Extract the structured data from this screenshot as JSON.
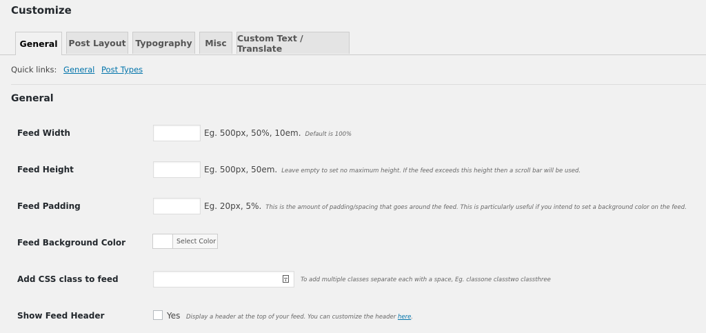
{
  "header": {
    "title": "Customize"
  },
  "tabs": [
    {
      "label": "General",
      "active": true
    },
    {
      "label": "Post Layout"
    },
    {
      "label": "Typography"
    },
    {
      "label": "Misc"
    },
    {
      "label": "Custom Text / Translate"
    }
  ],
  "quick_links": {
    "label": "Quick links:",
    "links": [
      "General",
      "Post Types"
    ]
  },
  "section": {
    "title": "General"
  },
  "settings": {
    "feed_width": {
      "label": "Feed Width",
      "value": "",
      "hint": "Eg. 500px, 50%, 10em.",
      "note": "Default is 100%"
    },
    "feed_height": {
      "label": "Feed Height",
      "value": "",
      "hint": "Eg. 500px, 50em.",
      "note": "Leave empty to set no maximum height. If the feed exceeds this height then a scroll bar will be used."
    },
    "feed_padding": {
      "label": "Feed Padding",
      "value": "",
      "hint": "Eg. 20px, 5%.",
      "note": "This is the amount of padding/spacing that goes around the feed. This is particularly useful if you intend to set a background color on the feed."
    },
    "feed_bg_color": {
      "label": "Feed Background Color",
      "button_label": "Select Color",
      "swatch": "#ffffff"
    },
    "css_class": {
      "label": "Add CSS class to feed",
      "value": "",
      "icon": "calendar-icon",
      "note": "To add multiple classes separate each with a space, Eg. classone classtwo classthree"
    },
    "show_header": {
      "label": "Show Feed Header",
      "checked": false,
      "option": "Yes",
      "note": "Display a header at the top of your feed. You can customize the header",
      "link": "here",
      "tail": "."
    }
  },
  "colors": {
    "link": "#0073aa",
    "bg": "#f1f1f1"
  }
}
